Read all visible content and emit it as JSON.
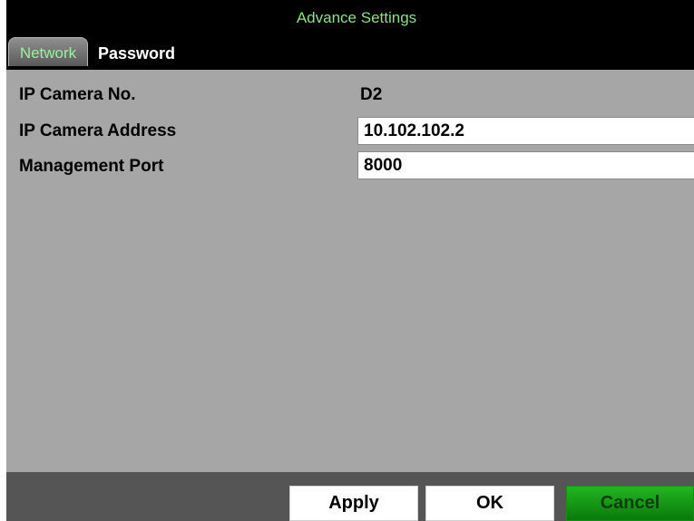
{
  "dialog": {
    "title": "Advance Settings",
    "tabs": [
      {
        "label": "Network",
        "active": true
      },
      {
        "label": "Password",
        "active": false
      }
    ]
  },
  "network": {
    "camera_no_label": "IP Camera No.",
    "camera_no_value": "D2",
    "address_label": "IP Camera Address",
    "address_value": "10.102.102.2",
    "port_label": "Management Port",
    "port_value": "8000"
  },
  "footer": {
    "apply_label": "Apply",
    "ok_label": "OK",
    "cancel_label": "Cancel"
  },
  "colors": {
    "title_text": "#8fe08a",
    "active_tab_text": "#9af29a",
    "panel_background": "#a6a6a6",
    "footer_background": "#555555",
    "cancel_button": "#22b622"
  }
}
